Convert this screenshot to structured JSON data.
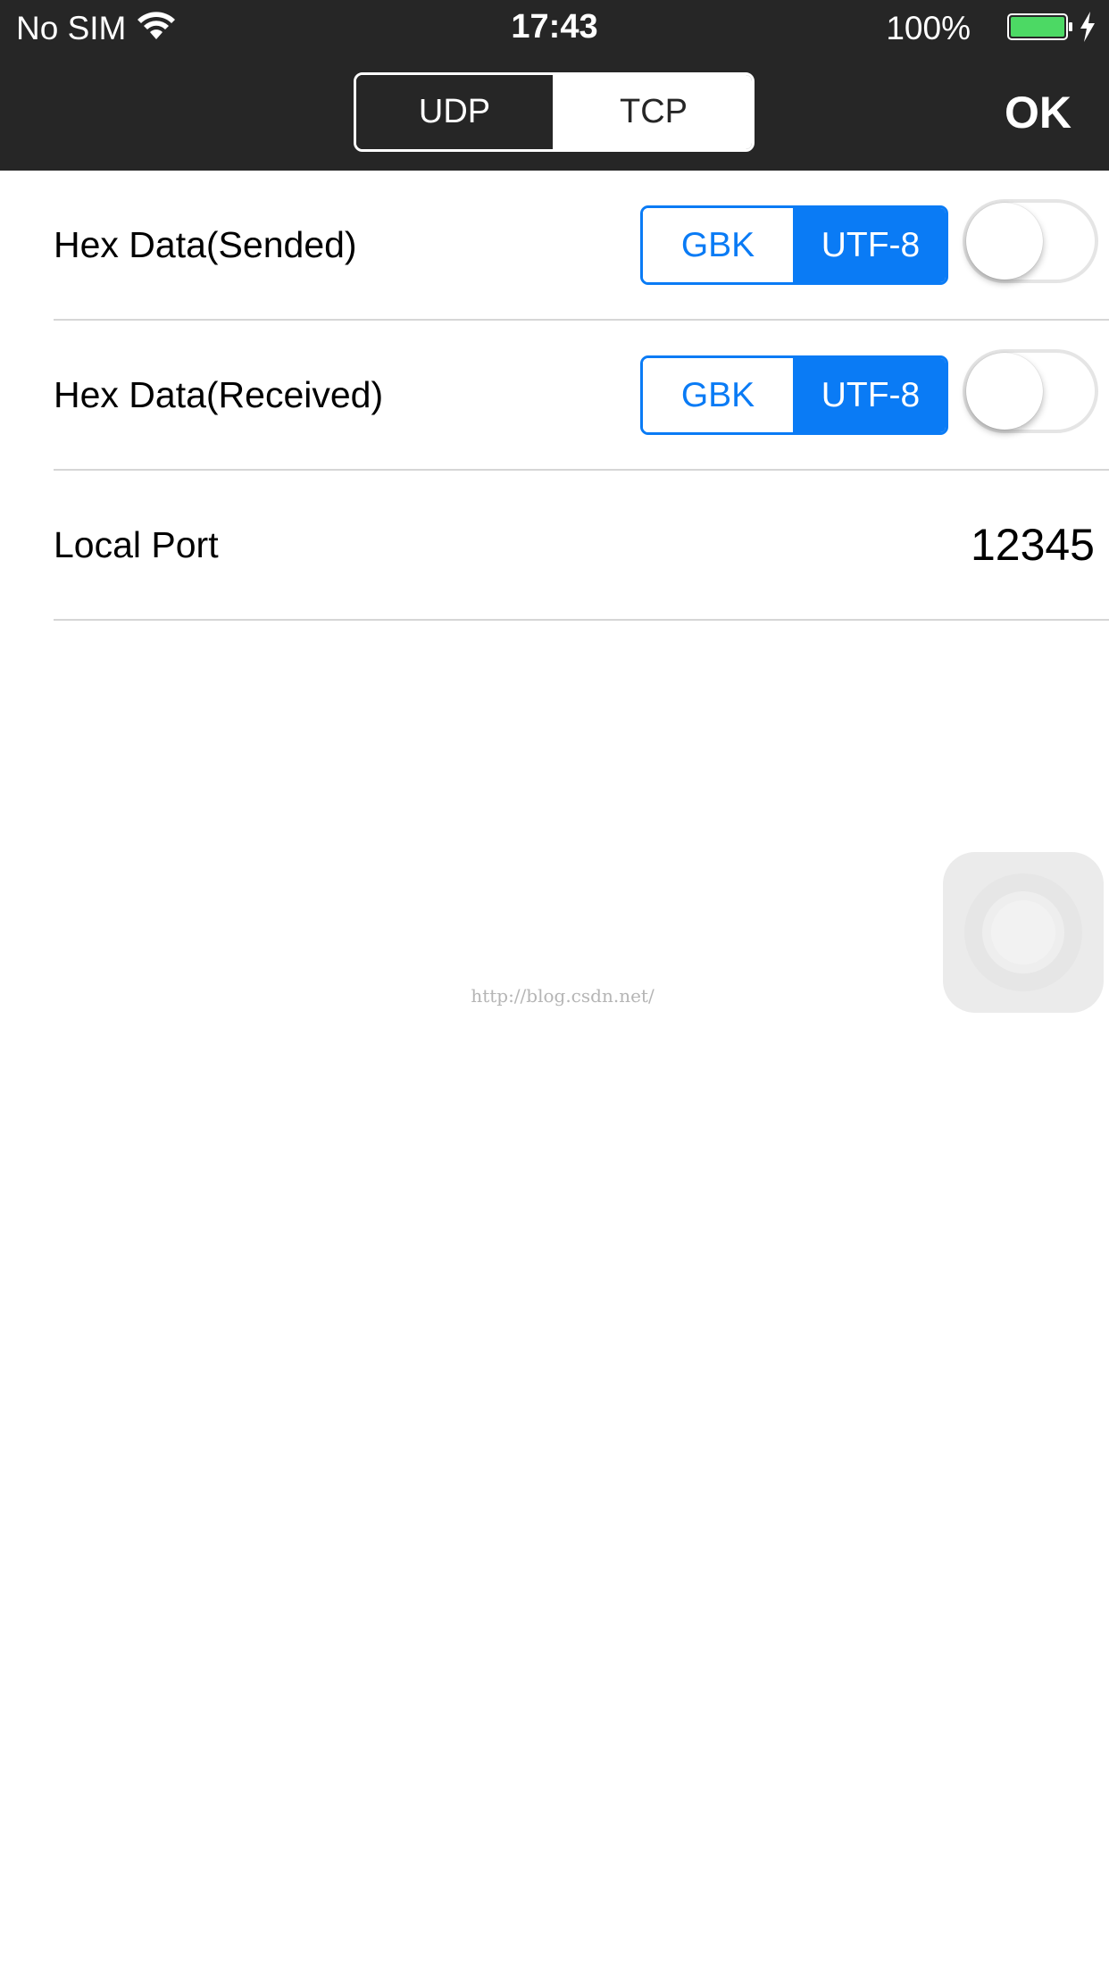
{
  "status_bar": {
    "carrier": "No SIM",
    "wifi_icon": "wifi-icon",
    "time": "17:43",
    "battery_percent": "100%",
    "battery_icon": "battery-icon",
    "charging_icon": "bolt-icon",
    "battery_color": "#4cd964"
  },
  "nav": {
    "protocol_segments": [
      {
        "label": "UDP",
        "selected": false
      },
      {
        "label": "TCP",
        "selected": true
      }
    ],
    "ok_label": "OK"
  },
  "settings": {
    "hex_sended": {
      "label": "Hex Data(Sended)",
      "encodings": [
        {
          "label": "GBK",
          "selected": false
        },
        {
          "label": "UTF-8",
          "selected": true
        }
      ],
      "toggle_on": false
    },
    "hex_received": {
      "label": "Hex Data(Received)",
      "encodings": [
        {
          "label": "GBK",
          "selected": false
        },
        {
          "label": "UTF-8",
          "selected": true
        }
      ],
      "toggle_on": false
    },
    "local_port": {
      "label": "Local Port",
      "value": "12345"
    }
  },
  "watermark": "http://blog.csdn.net/",
  "colors": {
    "accent": "#0a7bf5",
    "nav_background": "#262626",
    "separator": "#d6d6d6"
  }
}
